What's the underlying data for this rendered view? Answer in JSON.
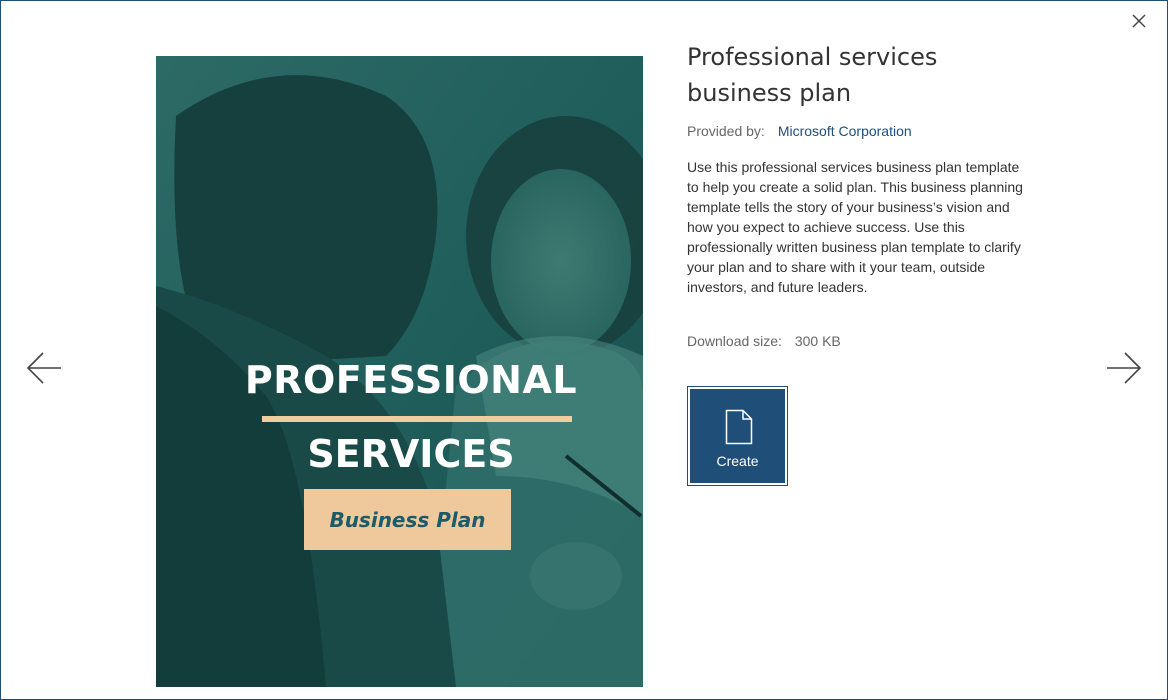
{
  "template": {
    "title": "Professional services business plan",
    "provider_label": "Provided by:",
    "provider_name": "Microsoft Corporation",
    "description": "Use this professional services business plan template to help you create a solid plan. This business planning template tells the story of your business’s vision and how you expect to achieve success. Use this professionally written business plan template to clarify your plan and to share with it your team, outside investors, and future leaders.",
    "download_label": "Download size:",
    "download_size": "300 KB"
  },
  "preview": {
    "line1": "PROFESSIONAL",
    "line2": "SERVICES",
    "badge": "Business Plan"
  },
  "actions": {
    "create_label": "Create"
  },
  "icons": {
    "close": "close-icon",
    "previous": "arrow-left-icon",
    "next": "arrow-right-icon",
    "create": "document-icon"
  },
  "colors": {
    "accent": "#1f4e79",
    "cover_overlay": "#1d5b5a",
    "cover_badge": "#efc99b",
    "cover_rule": "#f1cd9c"
  }
}
